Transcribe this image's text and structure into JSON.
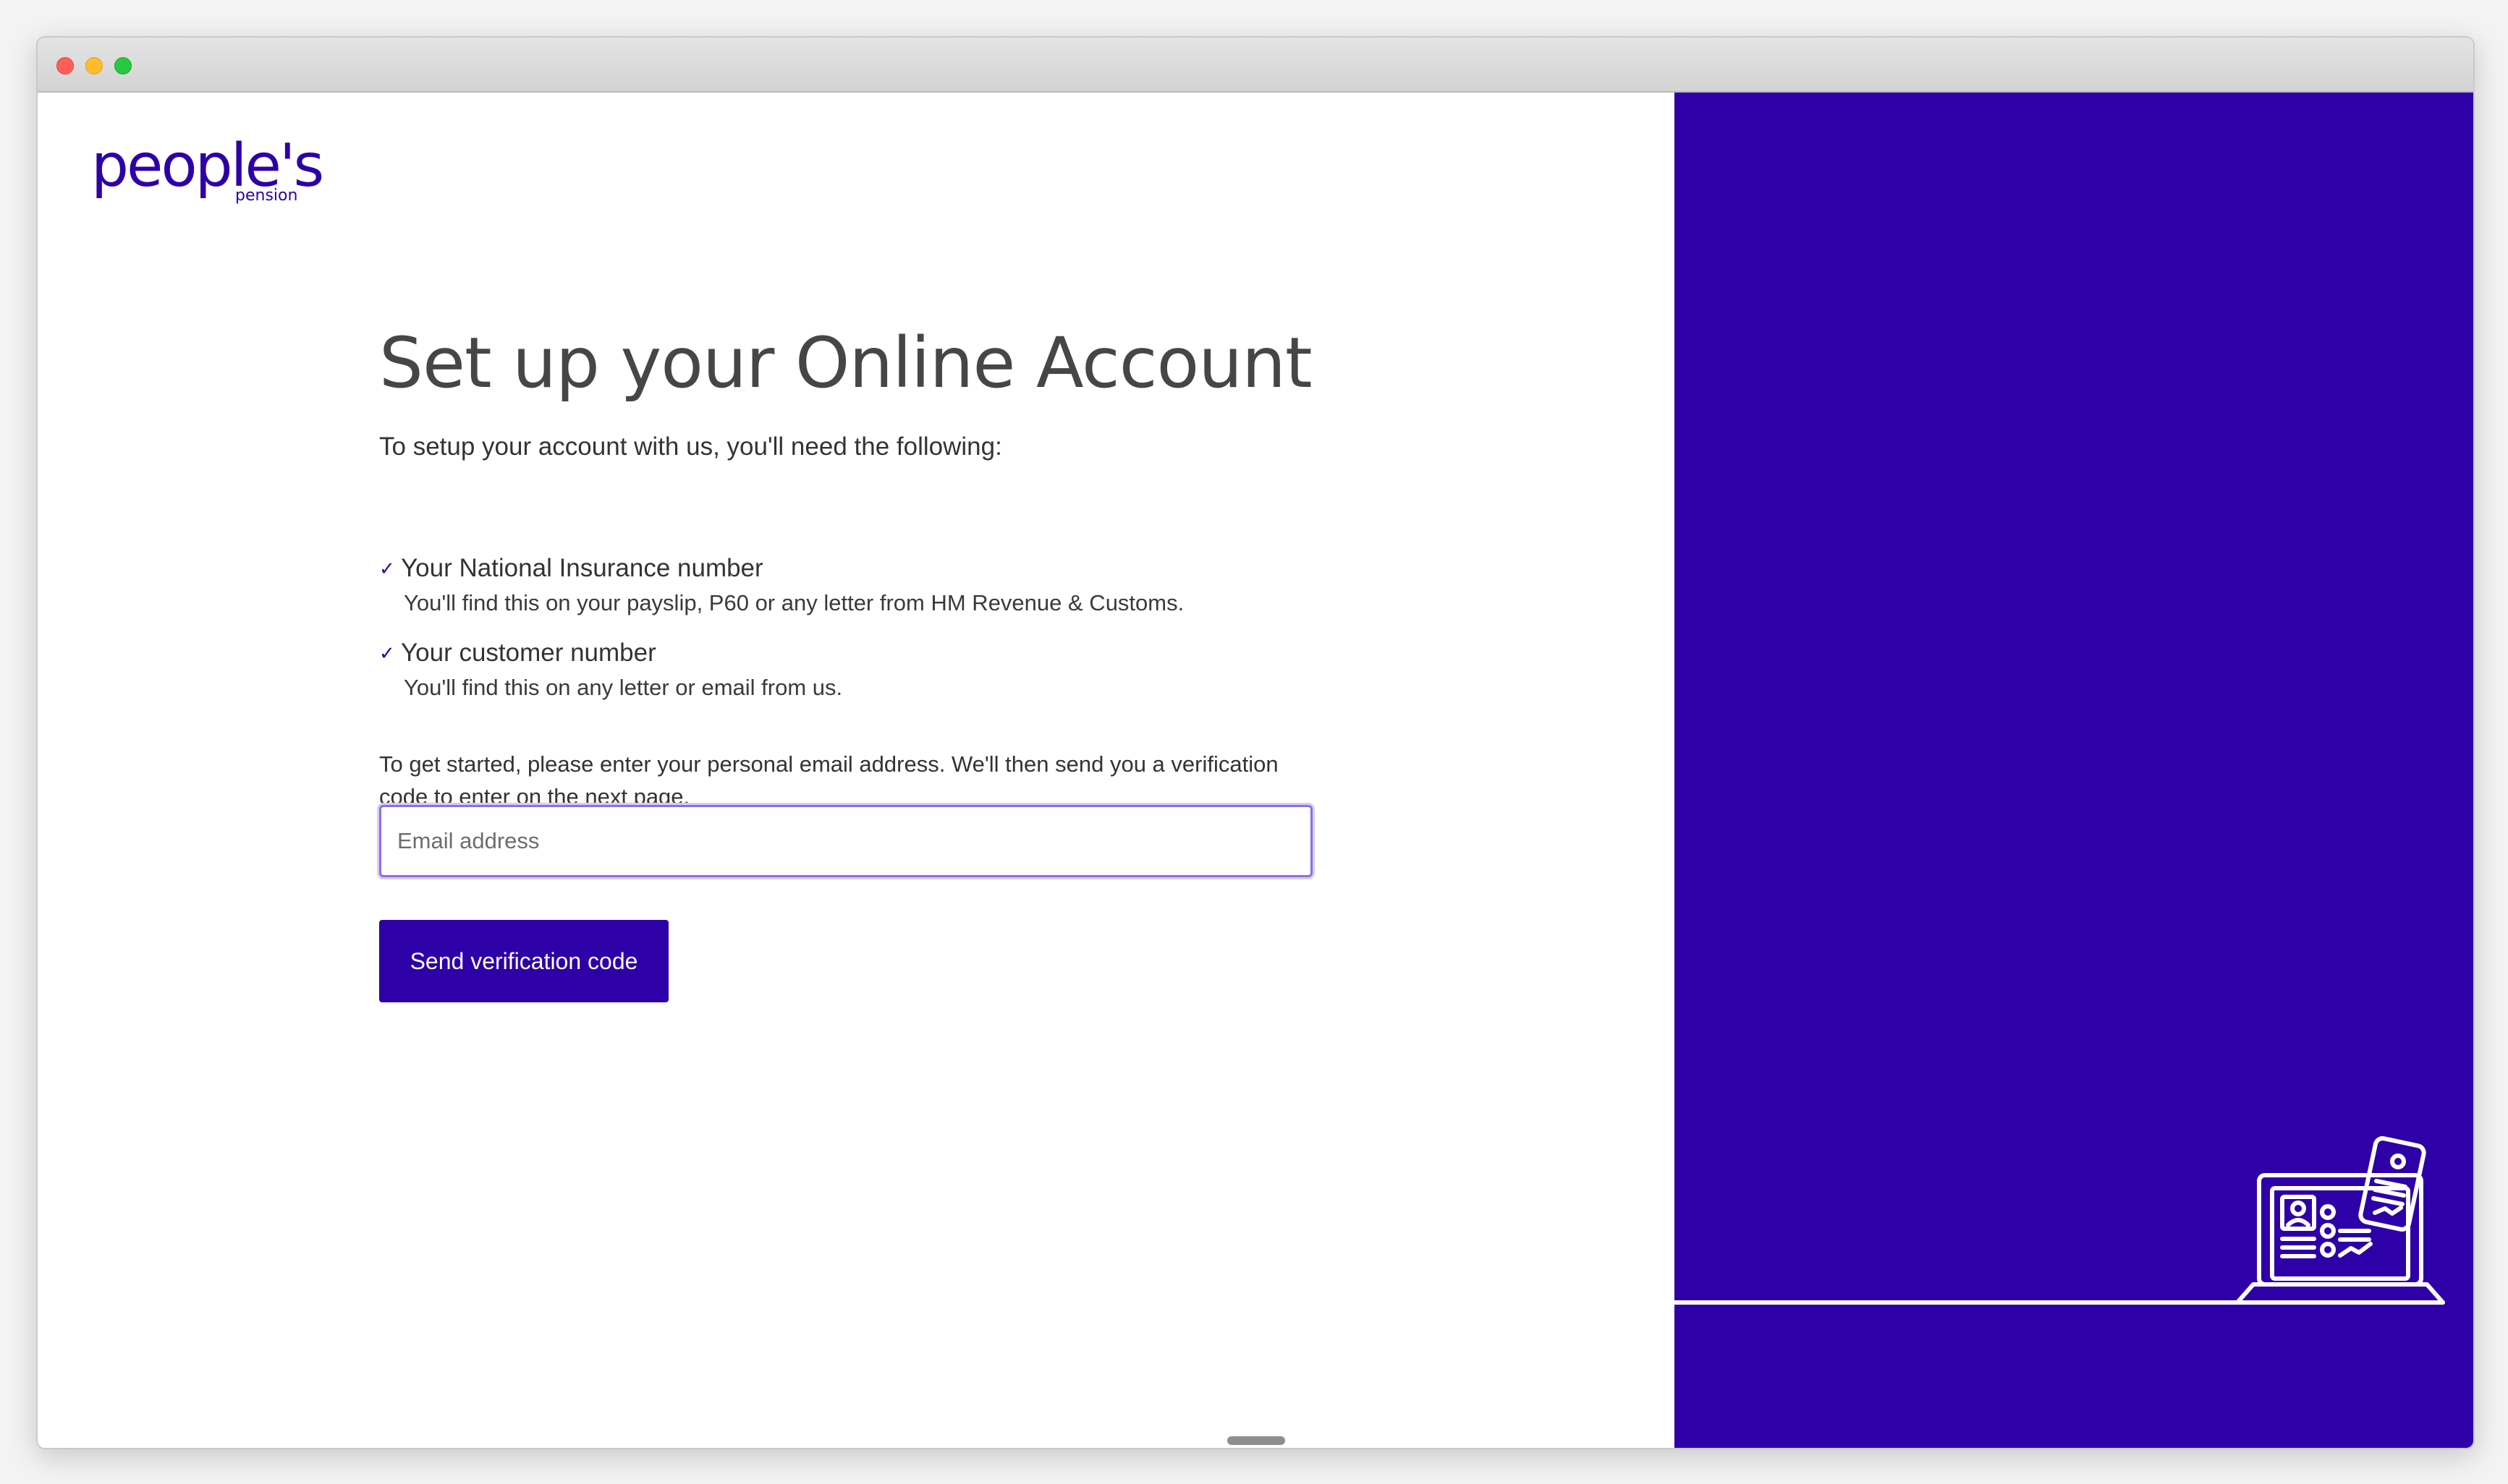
{
  "window": {
    "controls": [
      "close",
      "minimize",
      "zoom"
    ]
  },
  "logo": {
    "main": "people's",
    "sub": "pension"
  },
  "main": {
    "title": "Set up your Online Account",
    "intro": "To setup your account with us, you'll need the following:",
    "requirements": [
      {
        "title": "Your National Insurance number",
        "description": "You'll find this on your payslip, P60 or any letter from HM Revenue & Customs."
      },
      {
        "title": "Your customer number",
        "description": "You'll find this on any letter or email from us."
      }
    ],
    "instruction": "To get started, please enter your personal email address. We'll then send you a verification code to enter on the next page.",
    "email": {
      "value": "",
      "placeholder": "Email address"
    },
    "send_button_label": "Send verification code"
  },
  "colors": {
    "brand": "#2d00a8",
    "heading": "#464646",
    "text": "#333333",
    "input_focus_border": "#8a70e0"
  },
  "icons": {
    "check": "check-icon",
    "illustration": "laptop-phone-illustration"
  }
}
